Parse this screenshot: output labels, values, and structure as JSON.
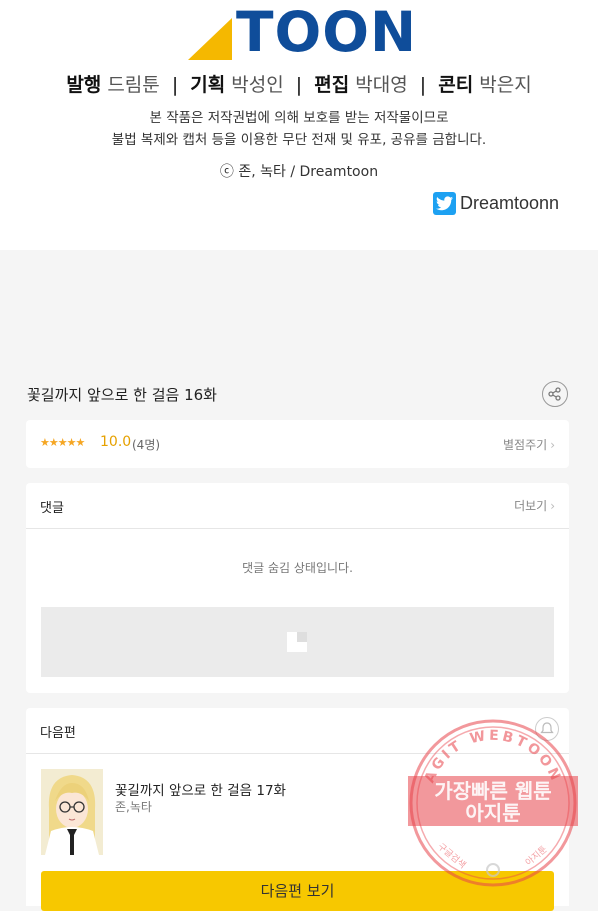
{
  "brand": {
    "logo_text": "TOON"
  },
  "credits": {
    "staff": [
      {
        "role": "발행",
        "name": "드림툰"
      },
      {
        "role": "기획",
        "name": "박성인"
      },
      {
        "role": "편집",
        "name": "박대영"
      },
      {
        "role": "콘티",
        "name": "박은지"
      }
    ],
    "separator": "|",
    "notice_line1": "본 작품은 저작권법에 의해 보호를 받는 저작물이므로",
    "notice_line2": "불법 복제와 캡처 등을 이용한 무단 전재 및 유포, 공유를 금합니다.",
    "copyright": "ⓒ 존, 녹타 / Dreamtoon",
    "twitter_handle": "Dreamtoonn"
  },
  "episode": {
    "title": "꽃길까지 앞으로 한 걸음 16화"
  },
  "rating": {
    "stars": "★★★★★",
    "score": "10.0",
    "count": "(4명)",
    "rate_label": "별점주기",
    "chevron": "›"
  },
  "comments": {
    "title": "댓글",
    "more_label": "더보기",
    "chevron": "›",
    "hidden_message": "댓글 숨김 상태입니다."
  },
  "next_episode": {
    "section_title": "다음편",
    "title": "꽃길까지 앞으로 한 걸음 17화",
    "author": "존,녹타",
    "button_label": "다음편 보기"
  },
  "watermark": {
    "arc_text": "AGIT WEBTOON",
    "line1": "가장빠른 웹툰",
    "line2": "아지툰",
    "bottom_left": "구글검색",
    "bottom_right": "아지툰"
  },
  "colors": {
    "brand_blue": "#0f4d9a",
    "brand_yellow": "#f5b800",
    "button_yellow": "#f7c800",
    "twitter_blue": "#1da1f2",
    "star_orange": "#f5a623",
    "watermark_red": "#e8434b"
  }
}
